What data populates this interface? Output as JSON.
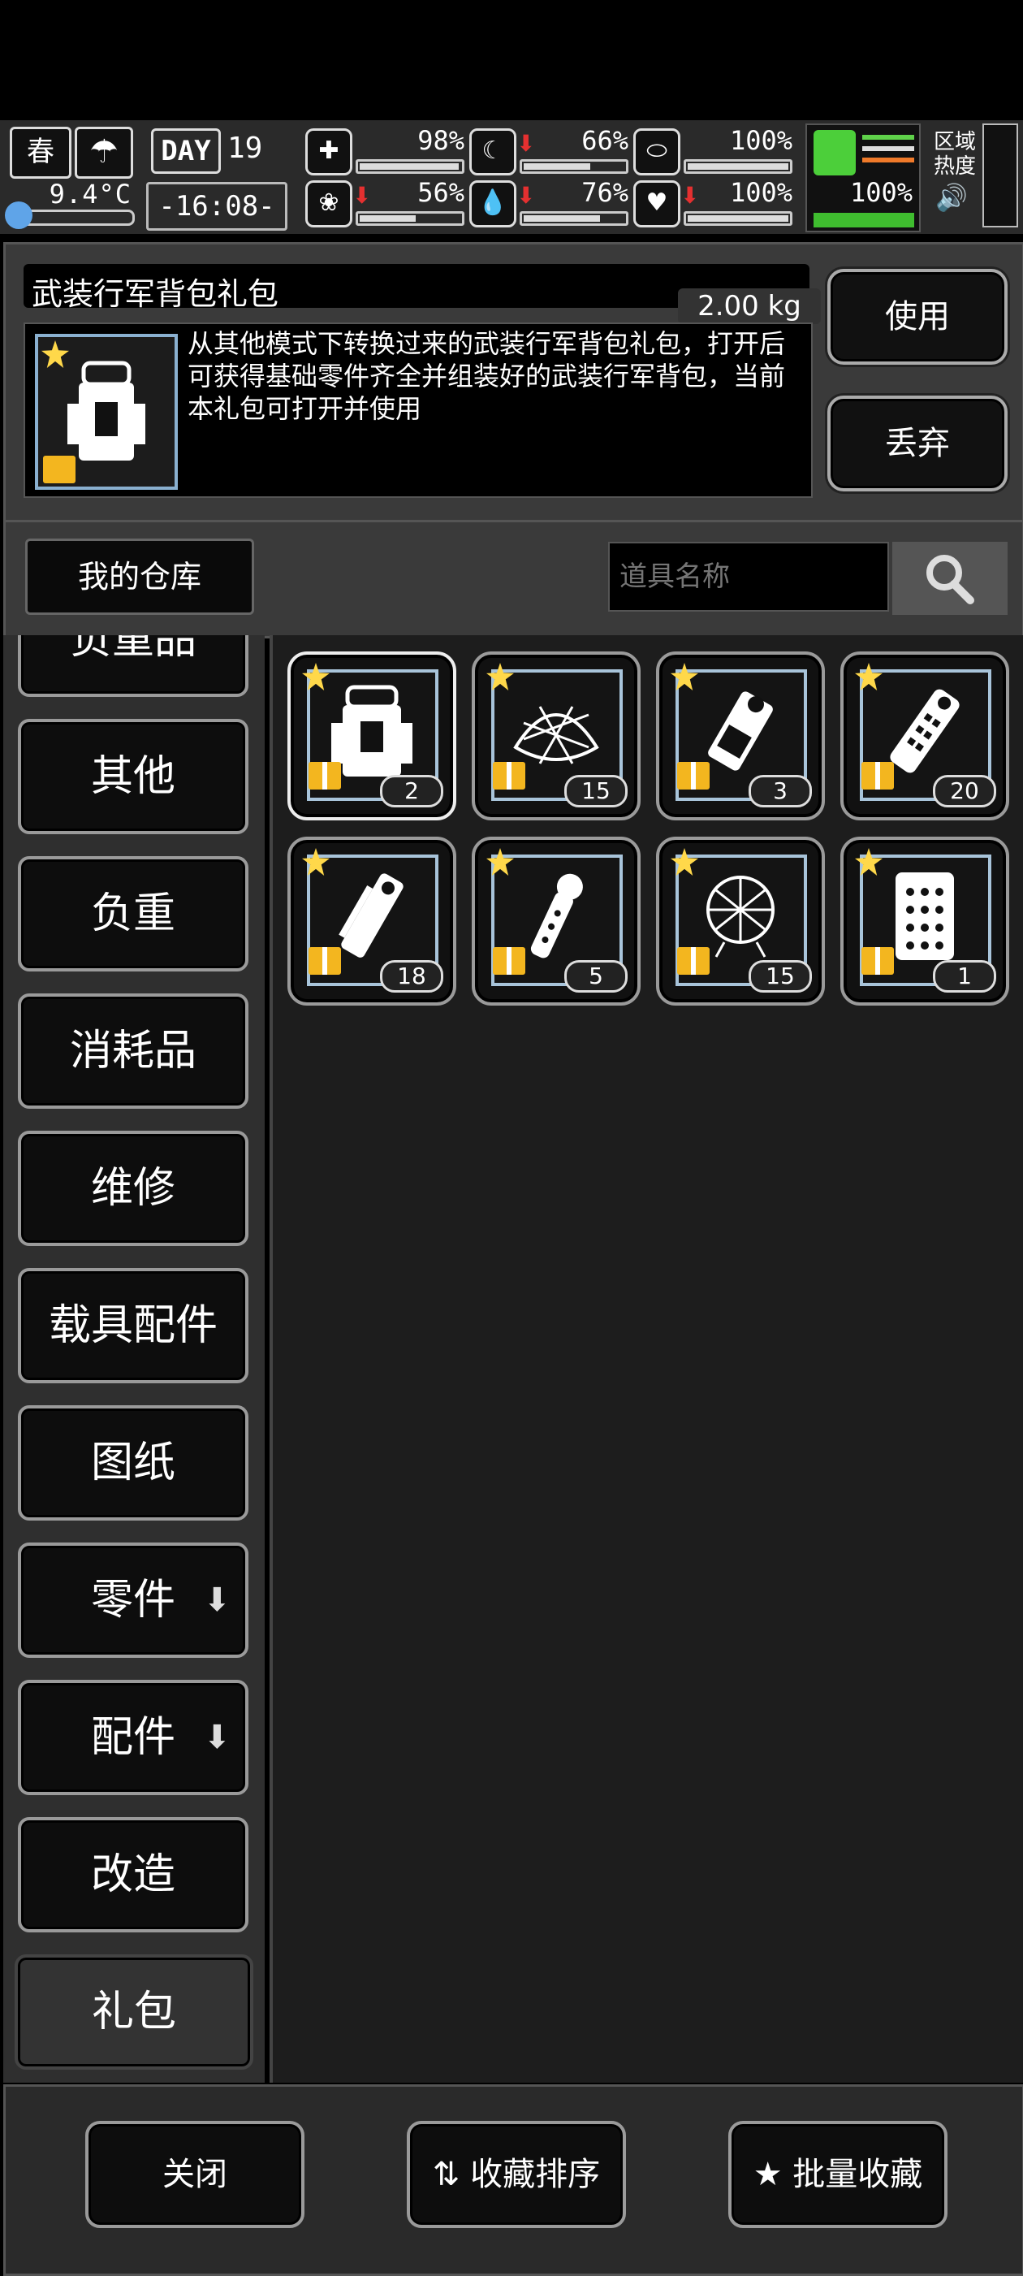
{
  "status": {
    "season": "春",
    "temperature": "9.4°C",
    "day_label": "DAY",
    "day_number": "19",
    "clock": "-16:08-",
    "stats": [
      {
        "icon": "medkit-icon",
        "glyph": "✚",
        "arrow": "",
        "pct": "98%",
        "fill": 0.98
      },
      {
        "icon": "stomach-icon",
        "glyph": "☾",
        "arrow": "⬇",
        "pct": "66%",
        "fill": 0.66
      },
      {
        "icon": "pill-icon",
        "glyph": "⬭",
        "arrow": "",
        "pct": "100%",
        "fill": 1.0
      },
      {
        "icon": "brain-icon",
        "glyph": "❀",
        "arrow": "⬇",
        "pct": "56%",
        "fill": 0.56
      },
      {
        "icon": "water-drop-icon",
        "glyph": "💧",
        "arrow": "⬇",
        "pct": "76%",
        "fill": 0.76
      },
      {
        "icon": "heart-icon",
        "glyph": "♥",
        "arrow": "⬇",
        "pct": "100%",
        "fill": 1.0
      }
    ],
    "stamina_pct": "100%",
    "zone_label": "区域热度",
    "speaker_glyph": "🔊"
  },
  "detail": {
    "title": "武装行军背包礼包",
    "weight": "2.00 kg",
    "description": "从其他模式下转换过来的武装行军背包礼包，打开后可获得基础零件齐全并组装好的武装行军背包，当前本礼包可打开并使用",
    "use_label": "使用",
    "discard_label": "丢弃"
  },
  "search": {
    "warehouse_label": "我的仓库",
    "placeholder": "道具名称"
  },
  "categories": [
    {
      "label": "负重品",
      "expand": false
    },
    {
      "label": "其他",
      "expand": false
    },
    {
      "label": "负重",
      "expand": false
    },
    {
      "label": "消耗品",
      "expand": false
    },
    {
      "label": "维修",
      "expand": false
    },
    {
      "label": "载具配件",
      "expand": false
    },
    {
      "label": "图纸",
      "expand": false
    },
    {
      "label": "零件",
      "expand": true
    },
    {
      "label": "配件",
      "expand": true
    },
    {
      "label": "改造",
      "expand": false
    },
    {
      "label": "礼包",
      "expand": false,
      "active": true
    }
  ],
  "items": [
    {
      "name": "backpack-gift",
      "count": "2",
      "selected": true
    },
    {
      "name": "net-gift",
      "count": "15"
    },
    {
      "name": "canister-gift",
      "count": "3"
    },
    {
      "name": "flashlight-gift",
      "count": "20"
    },
    {
      "name": "chainsaw-gift",
      "count": "18"
    },
    {
      "name": "torch-gift",
      "count": "5"
    },
    {
      "name": "net-bag-gift",
      "count": "15"
    },
    {
      "name": "plate-gift",
      "count": "1"
    }
  ],
  "bottom": {
    "close_label": "关闭",
    "sort_label": "收藏排序",
    "batch_label": "批量收藏"
  }
}
